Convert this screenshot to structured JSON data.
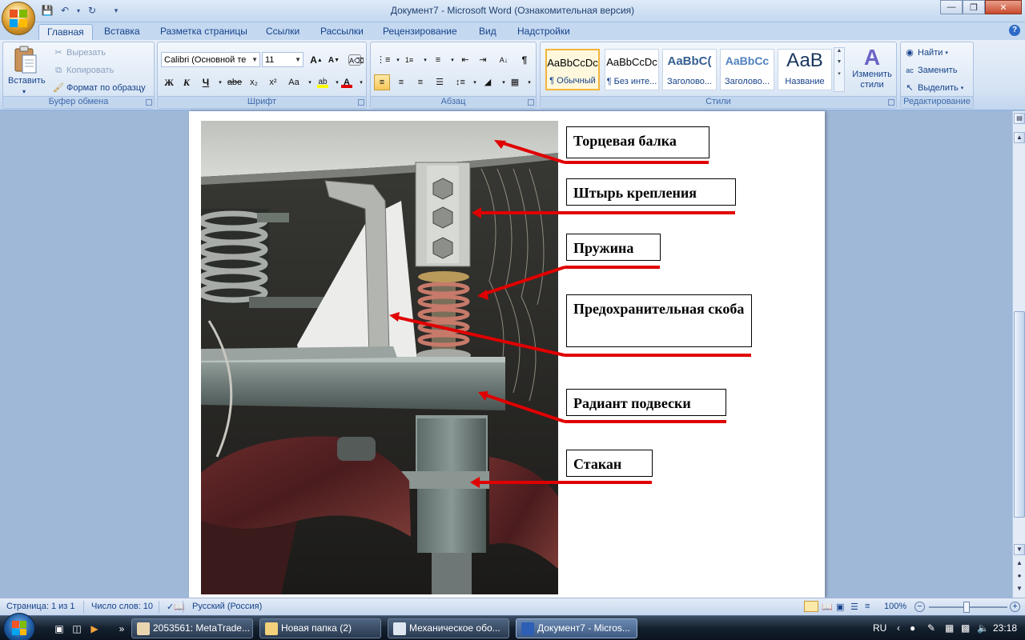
{
  "window": {
    "title": "Документ7 - Microsoft Word (Ознакомительная версия)"
  },
  "tabs": [
    "Главная",
    "Вставка",
    "Разметка страницы",
    "Ссылки",
    "Рассылки",
    "Рецензирование",
    "Вид",
    "Надстройки"
  ],
  "ribbon": {
    "clipboard": {
      "paste": "Вставить",
      "cut": "Вырезать",
      "copy": "Копировать",
      "format_painter": "Формат по образцу",
      "label": "Буфер обмена"
    },
    "font": {
      "name": "Calibri (Основной те",
      "size": "11",
      "bold": "Ж",
      "italic": "К",
      "underline": "Ч",
      "strike": "abe",
      "subscript": "x₂",
      "superscript": "x²",
      "case": "Aa",
      "grow": "A",
      "shrink": "A",
      "label": "Шрифт"
    },
    "paragraph": {
      "label": "Абзац",
      "pilcrow": "¶"
    },
    "styles": {
      "items": [
        {
          "sample": "AaBbCcDc",
          "name": "¶ Обычный"
        },
        {
          "sample": "AaBbCcDc",
          "name": "¶ Без инте..."
        },
        {
          "sample": "AaBbC(",
          "name": "Заголово..."
        },
        {
          "sample": "AaBbCc",
          "name": "Заголово..."
        },
        {
          "sample": "АаВ",
          "name": "Название"
        }
      ],
      "change_styles": "Изменить стили",
      "label": "Стили"
    },
    "editing": {
      "find": "Найти",
      "replace": "Заменить",
      "select": "Выделить",
      "label": "Редактирование"
    }
  },
  "document": {
    "labels": [
      "Торцевая балка",
      "Штырь  крепления",
      "Пружина",
      "Предохранительная скоба",
      "Радиант подвески",
      "Стакан"
    ]
  },
  "statusbar": {
    "page": "Страница: 1 из 1",
    "words": "Число слов: 10",
    "language": "Русский (Россия)",
    "zoom": "100%"
  },
  "taskbar": {
    "tasks": [
      "2053561: MetaTrade...",
      "Новая папка (2)",
      "Механическое обо...",
      "Документ7 - Micros..."
    ],
    "lang": "RU",
    "time": "23:18"
  },
  "colors": {
    "arrow": "#e00000",
    "ribbon_accent": "#15428b"
  }
}
